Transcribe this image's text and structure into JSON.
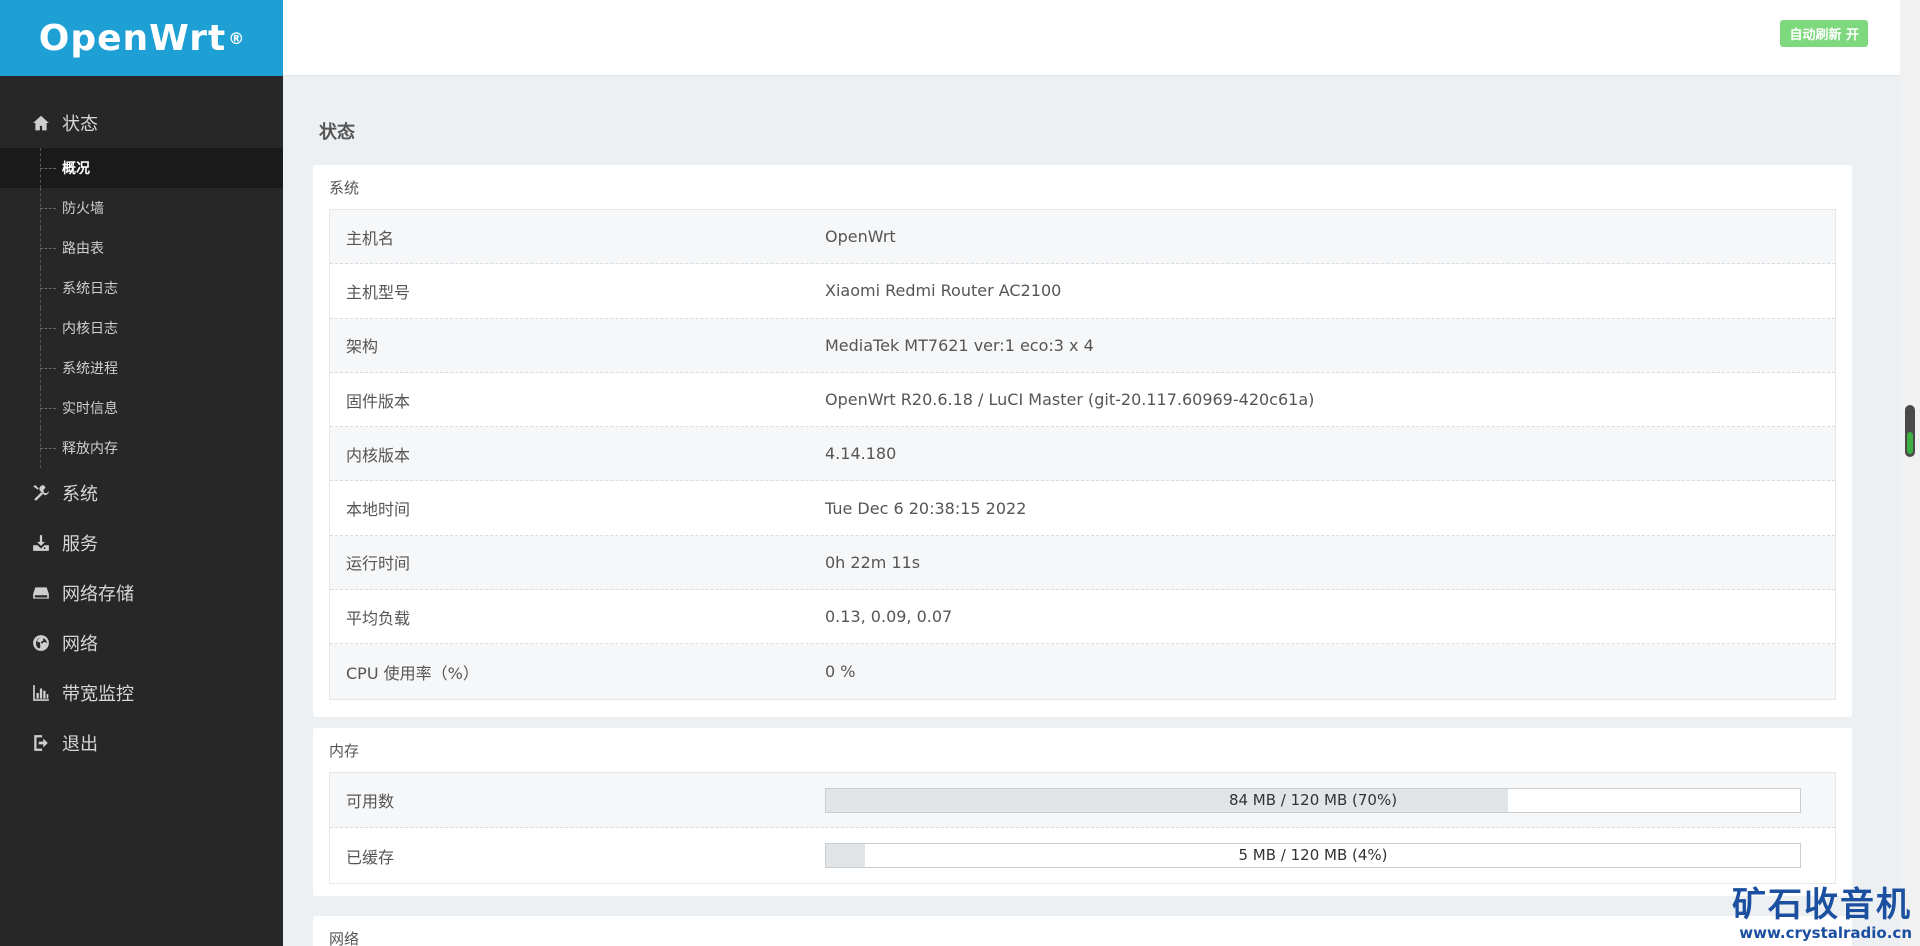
{
  "brand": {
    "name": "OpenWrt",
    "reg": "®"
  },
  "header": {
    "auto_refresh": "自动刷新 开"
  },
  "sidebar": {
    "status": {
      "label": "状态",
      "icon": "home-icon"
    },
    "sub_items": [
      "概况",
      "防火墙",
      "路由表",
      "系统日志",
      "内核日志",
      "系统进程",
      "实时信息",
      "释放内存"
    ],
    "active_sub": "概况",
    "items": [
      {
        "label": "系统",
        "icon": "tools-icon"
      },
      {
        "label": "服务",
        "icon": "download-icon"
      },
      {
        "label": "网络存储",
        "icon": "drive-icon"
      },
      {
        "label": "网络",
        "icon": "globe-icon"
      },
      {
        "label": "带宽监控",
        "icon": "bar-chart-icon"
      },
      {
        "label": "退出",
        "icon": "logout-icon"
      }
    ]
  },
  "main": {
    "page_title": "状态",
    "system": {
      "title": "系统",
      "rows": [
        {
          "key": "主机名",
          "value": "OpenWrt"
        },
        {
          "key": "主机型号",
          "value": "Xiaomi Redmi Router AC2100"
        },
        {
          "key": "架构",
          "value": "MediaTek MT7621 ver:1 eco:3 x 4"
        },
        {
          "key": "固件版本",
          "value": "OpenWrt R20.6.18 / LuCI Master (git-20.117.60969-420c61a)"
        },
        {
          "key": "内核版本",
          "value": "4.14.180"
        },
        {
          "key": "本地时间",
          "value": "Tue Dec 6 20:38:15 2022"
        },
        {
          "key": "运行时间",
          "value": "0h 22m 11s"
        },
        {
          "key": "平均负载",
          "value": "0.13, 0.09, 0.07"
        },
        {
          "key": "CPU 使用率（%）",
          "value": "0 %"
        }
      ]
    },
    "memory": {
      "title": "内存",
      "rows": [
        {
          "key": "可用数",
          "text": "84 MB / 120 MB (70%)",
          "percent": 70
        },
        {
          "key": "已缓存",
          "text": "5 MB / 120 MB (4%)",
          "percent": 4
        }
      ]
    },
    "network": {
      "title": "网络"
    }
  },
  "watermark": {
    "cn": "矿石收音机",
    "url": "www.crystalradio.cn"
  }
}
